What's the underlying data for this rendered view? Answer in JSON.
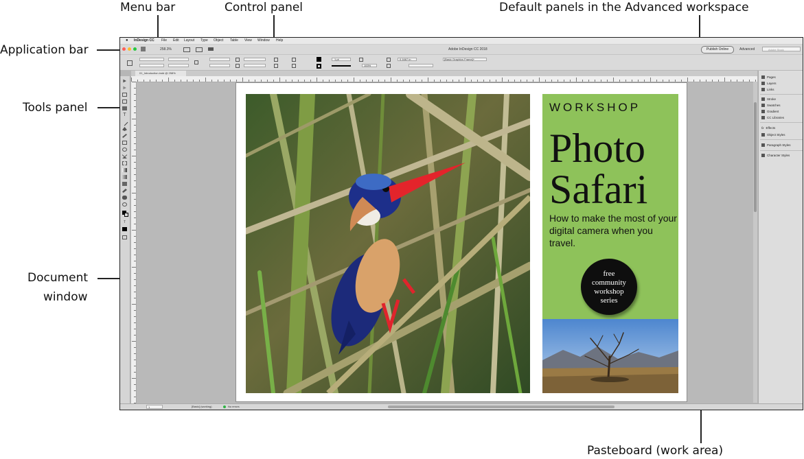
{
  "callouts": {
    "menu_bar": "Menu bar",
    "control_panel": "Control panel",
    "default_panels": "Default panels in the Advanced workspace",
    "application_bar": "Application bar",
    "tools_panel": "Tools panel",
    "document_window_line1": "Document",
    "document_window_line2": "window",
    "pasteboard": "Pasteboard (work area)"
  },
  "menubar": {
    "apple": "",
    "app_name": "InDesign CC",
    "items": [
      "File",
      "Edit",
      "Layout",
      "Type",
      "Object",
      "Table",
      "View",
      "Window",
      "Help"
    ]
  },
  "appbar": {
    "zoom": "258.3%",
    "title": "Adobe InDesign CC 2018",
    "publish_button": "Publish Online",
    "workspace": "Advanced",
    "search_placeholder": "Adobe Stock",
    "colors": {
      "close": "#ff5f57",
      "minimize": "#febc2e",
      "zoom": "#28c840"
    }
  },
  "control": {
    "stroke_weight": "1 pt",
    "scale": "100%",
    "frame_style": "[Basic Graphics Frame]+",
    "value": "0.1667 in"
  },
  "document": {
    "tab_label": "01_Introduction.indd @ 258%"
  },
  "statusbar": {
    "page": "1",
    "style": "[Basic] (working)",
    "errors": "No errors"
  },
  "panels": {
    "items": [
      "Pages",
      "Layers",
      "Links",
      "Stroke",
      "Swatches",
      "Gradient",
      "CC Libraries",
      "Effects",
      "Object Styles",
      "Paragraph Styles",
      "Character Styles"
    ],
    "effects_glyph": "fx"
  },
  "poster": {
    "workshop": "WORKSHOP",
    "title_line1": "Photo",
    "title_line2": "Safari",
    "subtitle": "How to make the most of your digital camera when you travel.",
    "badge_line1": "free",
    "badge_line2": "community",
    "badge_line3": "workshop",
    "badge_line4": "series",
    "green": "#8ec25a"
  }
}
